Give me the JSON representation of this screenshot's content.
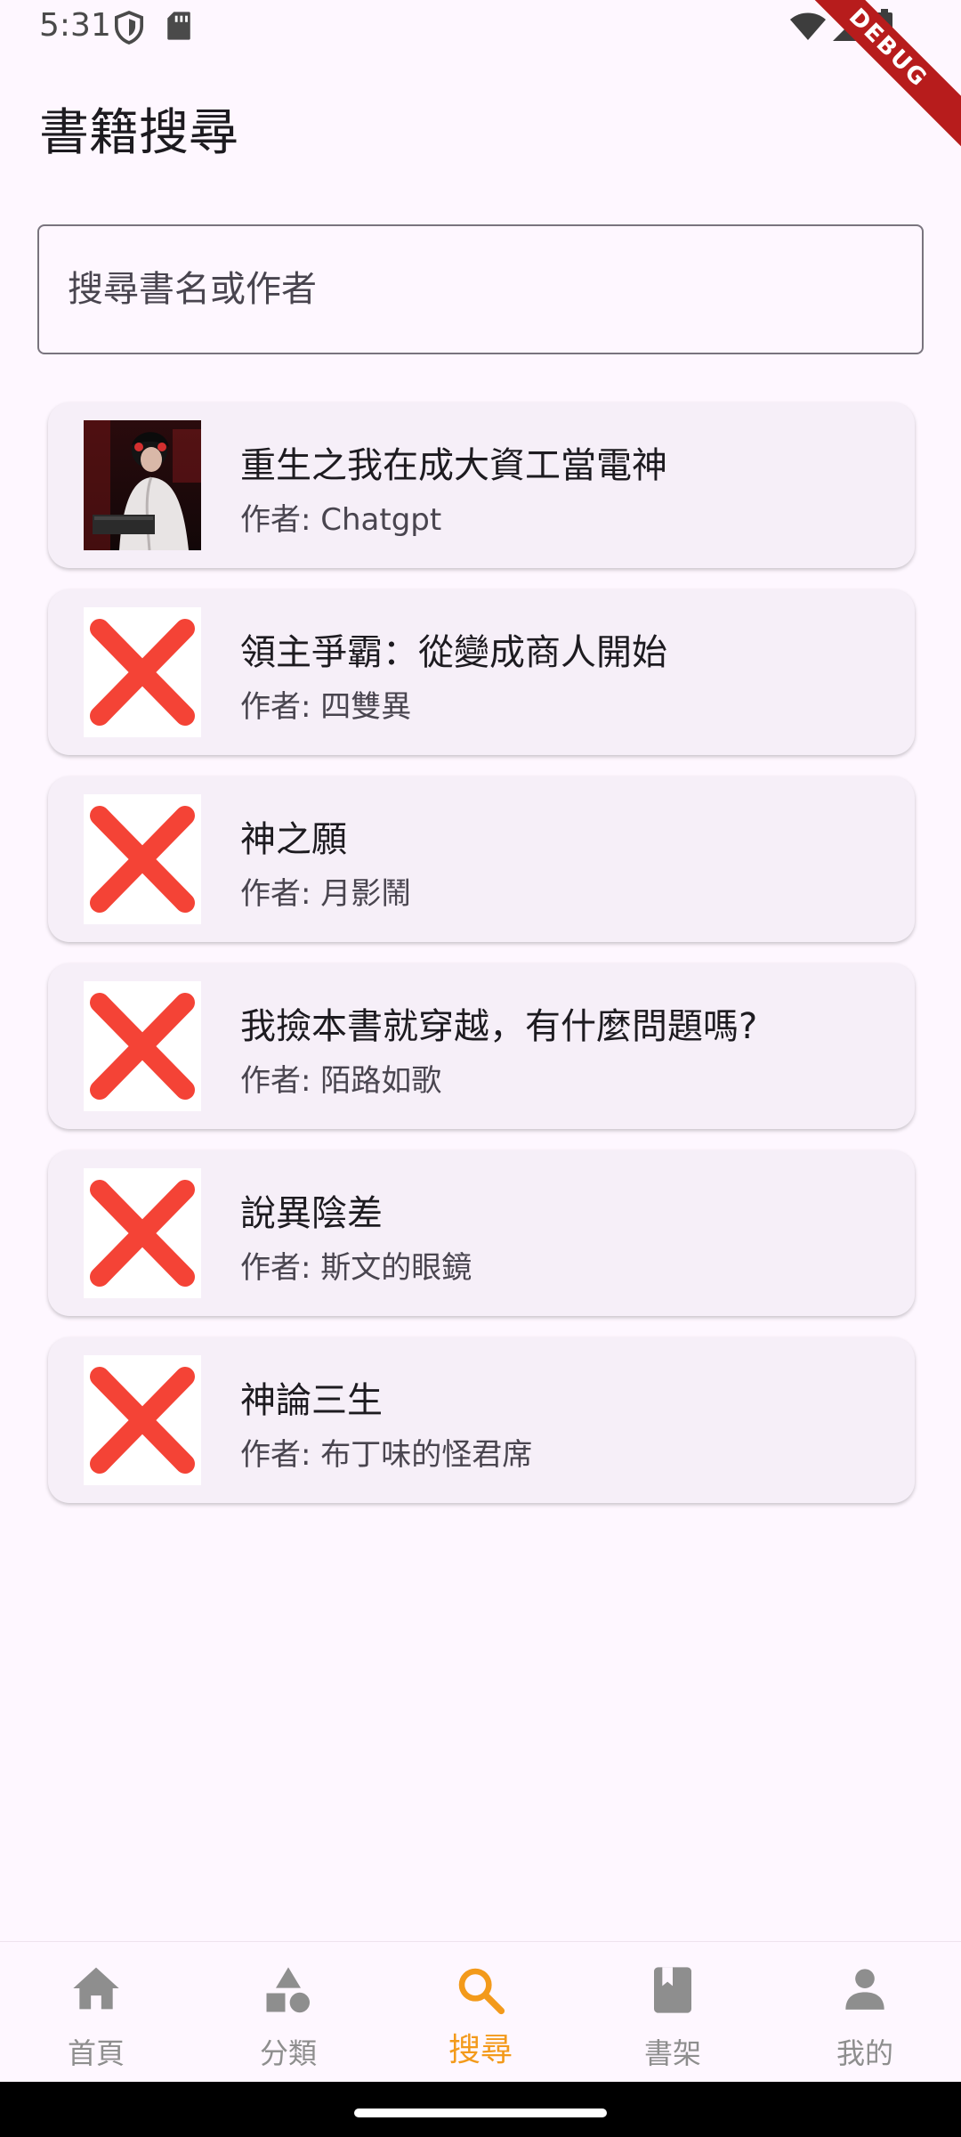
{
  "status_bar": {
    "time": "5:31",
    "debug_label": "DEBUG"
  },
  "page": {
    "title": "書籍搜尋"
  },
  "search": {
    "placeholder": "搜尋書名或作者",
    "value": ""
  },
  "books": [
    {
      "title": "重生之我在成大資工當電神",
      "author": "作者: Chatgpt",
      "cover": "cover-image"
    },
    {
      "title": "領主爭霸：從變成商人開始",
      "author": "作者: 四雙異",
      "cover": "missing-image-icon"
    },
    {
      "title": "神之願",
      "author": "作者: 月影鬧",
      "cover": "missing-image-icon"
    },
    {
      "title": "我撿本書就穿越，有什麼問題嗎?",
      "author": "作者: 陌路如歌",
      "cover": "missing-image-icon"
    },
    {
      "title": "說異陰差",
      "author": "作者: 斯文的眼鏡",
      "cover": "missing-image-icon"
    },
    {
      "title": "神論三生",
      "author": "作者: 布丁味的怪君席",
      "cover": "missing-image-icon"
    }
  ],
  "nav": {
    "items": [
      {
        "label": "首頁",
        "icon": "home-icon"
      },
      {
        "label": "分類",
        "icon": "category-icon"
      },
      {
        "label": "搜尋",
        "icon": "search-icon",
        "active": true
      },
      {
        "label": "書架",
        "icon": "bookmark-book-icon"
      },
      {
        "label": "我的",
        "icon": "person-icon"
      }
    ]
  },
  "colors": {
    "background": "#FEF7FF",
    "card": "#F6EFF8",
    "accent": "#F39A1B",
    "inactive": "#8E8E8E",
    "error_x": "#F44336"
  }
}
